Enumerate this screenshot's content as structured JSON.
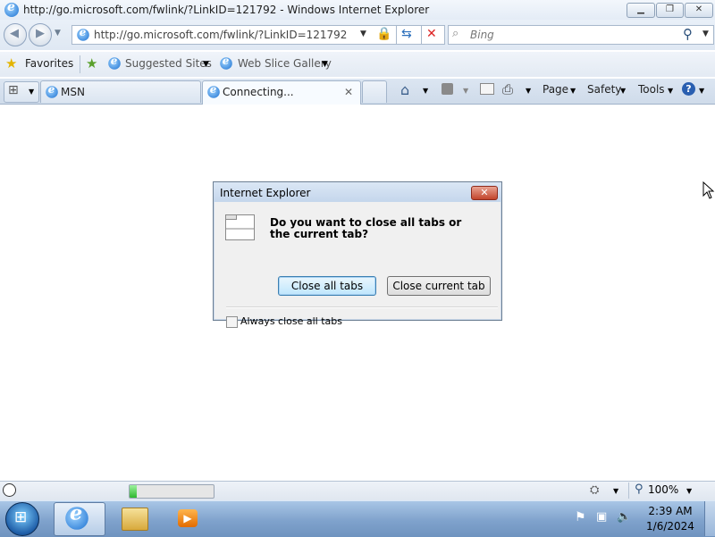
{
  "window": {
    "title": "http://go.microsoft.com/fwlink/?LinkID=121792 - Windows Internet Explorer"
  },
  "address_bar": {
    "url": "http://go.microsoft.com/fwlink/?LinkID=121792",
    "search_placeholder": "Bing"
  },
  "favorites_bar": {
    "favorites_label": "Favorites",
    "items": [
      {
        "label": "Suggested Sites"
      },
      {
        "label": "Web Slice Gallery"
      }
    ]
  },
  "tabs": [
    {
      "label": "MSN"
    },
    {
      "label": "Connecting..."
    }
  ],
  "command_bar": {
    "page_label": "Page",
    "safety_label": "Safety",
    "tools_label": "Tools"
  },
  "dialog": {
    "title": "Internet Explorer",
    "message": "Do you want to close all tabs or the current tab?",
    "close_all_label": "Close all tabs",
    "close_current_label": "Close current tab",
    "checkbox_label": "Always close all tabs",
    "checkbox_checked": false
  },
  "status_bar": {
    "zoom": "100%",
    "progress_fraction": 0.08
  },
  "taskbar": {
    "time": "2:39 AM",
    "date": "1/6/2024"
  },
  "colors": {
    "accent": "#1a6fd0",
    "progress_green": "#2fb82f",
    "close_red": "#c2452c"
  }
}
